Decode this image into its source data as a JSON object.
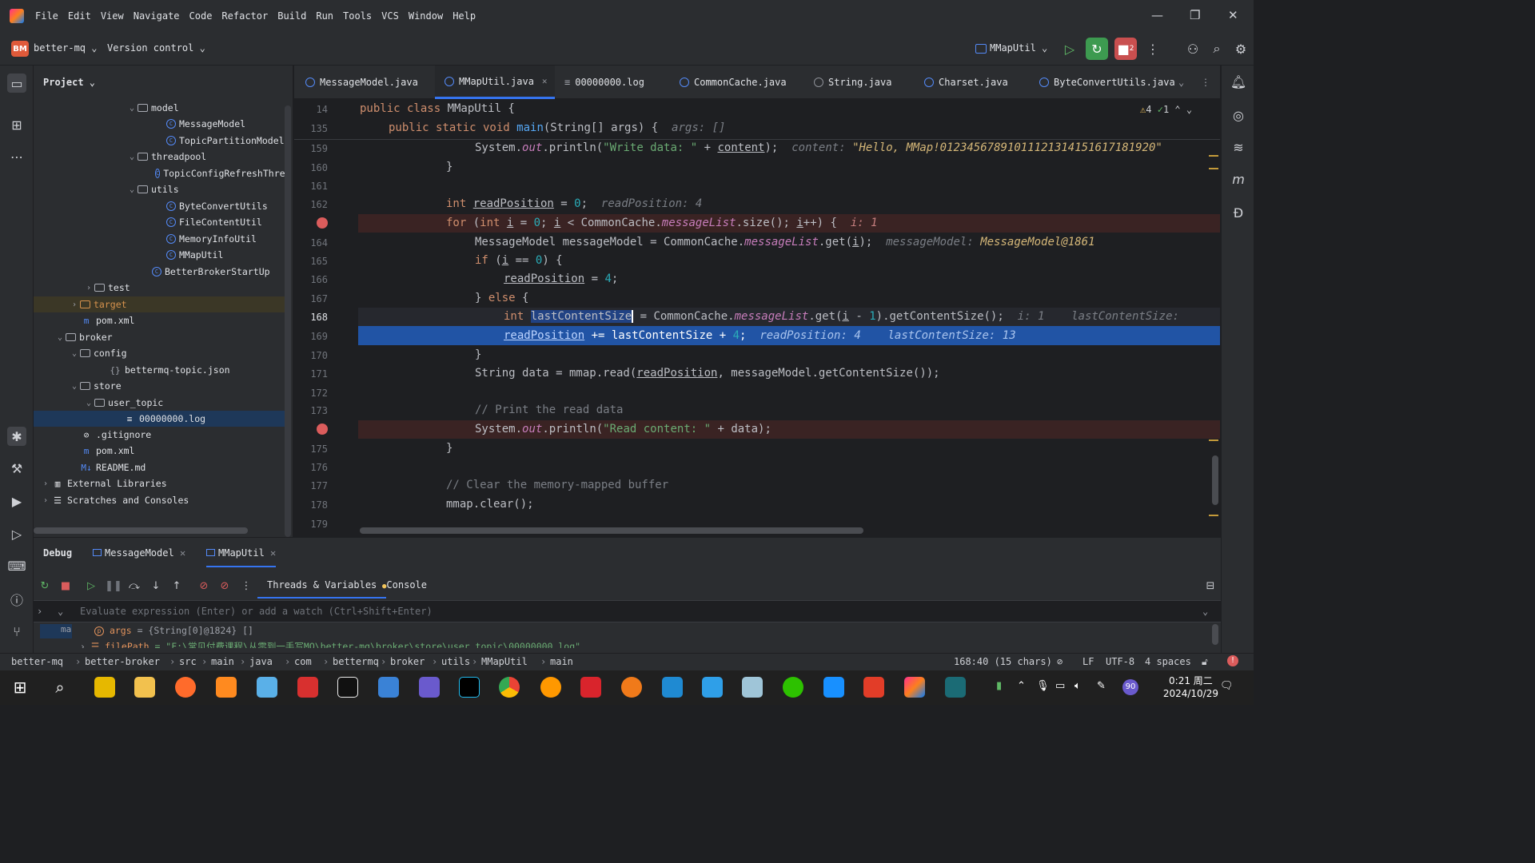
{
  "menu": [
    "File",
    "Edit",
    "View",
    "Navigate",
    "Code",
    "Refactor",
    "Build",
    "Run",
    "Tools",
    "VCS",
    "Window",
    "Help"
  ],
  "toolbar": {
    "project_badge": "BM",
    "project_name": "better-mq",
    "vcs": "Version control",
    "run_config": "MMapUtil",
    "stop_count": "2"
  },
  "project_panel": {
    "title": "Project",
    "rows": [
      {
        "label": "model",
        "depth": 6,
        "type": "folder",
        "arrow": "open"
      },
      {
        "label": "MessageModel",
        "depth": 8,
        "type": "class"
      },
      {
        "label": "TopicPartitionModel",
        "depth": 8,
        "type": "class"
      },
      {
        "label": "threadpool",
        "depth": 6,
        "type": "folder",
        "arrow": "open"
      },
      {
        "label": "TopicConfigRefreshThread",
        "depth": 8,
        "type": "class"
      },
      {
        "label": "utils",
        "depth": 6,
        "type": "folder",
        "arrow": "open"
      },
      {
        "label": "ByteConvertUtils",
        "depth": 8,
        "type": "class"
      },
      {
        "label": "FileContentUtil",
        "depth": 8,
        "type": "class"
      },
      {
        "label": "MemoryInfoUtil",
        "depth": 8,
        "type": "class"
      },
      {
        "label": "MMapUtil",
        "depth": 8,
        "type": "class"
      },
      {
        "label": "BetterBrokerStartUp",
        "depth": 7,
        "type": "class"
      },
      {
        "label": "test",
        "depth": 3,
        "type": "folder",
        "arrow": "closed"
      },
      {
        "label": "target",
        "depth": 2,
        "type": "folder-orange",
        "arrow": "closed"
      },
      {
        "label": "pom.xml",
        "depth": 2,
        "type": "maven"
      },
      {
        "label": "broker",
        "depth": 1,
        "type": "folder",
        "arrow": "open"
      },
      {
        "label": "config",
        "depth": 2,
        "type": "folder",
        "arrow": "open"
      },
      {
        "label": "bettermq-topic.json",
        "depth": 4,
        "type": "json"
      },
      {
        "label": "store",
        "depth": 2,
        "type": "folder",
        "arrow": "open"
      },
      {
        "label": "user_topic",
        "depth": 3,
        "type": "folder",
        "arrow": "open"
      },
      {
        "label": "00000000.log",
        "depth": 5,
        "type": "log"
      },
      {
        "label": ".gitignore",
        "depth": 2,
        "type": "ignore"
      },
      {
        "label": "pom.xml",
        "depth": 2,
        "type": "maven"
      },
      {
        "label": "README.md",
        "depth": 2,
        "type": "md"
      },
      {
        "label": "External Libraries",
        "depth": 0,
        "type": "lib",
        "arrow": "closed"
      },
      {
        "label": "Scratches and Consoles",
        "depth": 0,
        "type": "scratch",
        "arrow": "closed"
      }
    ]
  },
  "tabs": [
    {
      "label": "MessageModel.java",
      "active": false
    },
    {
      "label": "MMapUtil.java",
      "active": true
    },
    {
      "label": "00000000.log",
      "active": false
    },
    {
      "label": "CommonCache.java",
      "active": false
    },
    {
      "label": "String.java",
      "active": false
    },
    {
      "label": "Charset.java",
      "active": false
    },
    {
      "label": "ByteConvertUtils.java",
      "active": false
    }
  ],
  "editor": {
    "warnings": "4",
    "checks": "1",
    "lines": [
      "14",
      "135",
      "159",
      "160",
      "161",
      "162",
      "",
      "164",
      "165",
      "166",
      "167",
      "168",
      "169",
      "170",
      "171",
      "172",
      "173",
      "",
      "175",
      "176",
      "177",
      "178",
      "179"
    ],
    "sticky1": {
      "kw": "public class ",
      "name": "MMapUtil {"
    },
    "sticky2": {
      "kw": "public static void ",
      "fn": "main",
      "rest": "(String[] args) {",
      "hint": "args: []"
    },
    "l159": {
      "a": "System.",
      "b": "out",
      "c": ".println(",
      "s": "\"Write data: \"",
      "d": " + ",
      "e": "content",
      "f": ");",
      "hint": "content: ",
      "hv": "\"Hello, MMap!01234567891011121314151617181920\""
    },
    "l160": "}",
    "l162": {
      "kw": "int ",
      "v": "readPosition",
      "r": " = ",
      "n": "0",
      "e": ";",
      "hint": "readPosition: 4"
    },
    "l163": {
      "kw": "for ",
      "a": "(",
      "kw2": "int ",
      "i": "i",
      "b": " = ",
      "n": "0",
      "c": "; ",
      "i2": "i",
      "d": " < CommonCache.",
      "it": "messageList",
      "e": ".size(); ",
      "i3": "i",
      "f": "++) {",
      "hint": "i: 1"
    },
    "l164": {
      "a": "MessageModel messageModel = CommonCache.",
      "it": "messageList",
      "b": ".get(",
      "i": "i",
      "c": ");",
      "hint": "messageModel: ",
      "hv": "MessageModel@1861"
    },
    "l165": {
      "kw": "if ",
      "a": "(",
      "i": "i",
      "b": " == ",
      "n": "0",
      "c": ") {"
    },
    "l166": {
      "v": "readPosition",
      "a": " = ",
      "n": "4",
      "b": ";"
    },
    "l167": {
      "a": "} ",
      "kw": "else ",
      "b": "{"
    },
    "l168": {
      "kw": "int ",
      "v": "lastContentSize",
      "a": " = CommonCache.",
      "it": "messageList",
      "b": ".get(",
      "i": "i",
      "c": " - ",
      "n": "1",
      "d": ").getContentSize();",
      "hint": "i: 1",
      "hint2": "lastContentSize:"
    },
    "l169": {
      "v": "readPosition",
      "a": " += lastContentSize + ",
      "n": "4",
      "b": ";",
      "hint": "readPosition: 4",
      "hint2": "lastContentSize: 13"
    },
    "l170": "}",
    "l171": {
      "a": "String data = mmap.read(",
      "v": "readPosition",
      "b": ", messageModel.getContentSize());"
    },
    "l173": "// Print the read data",
    "l174": {
      "a": "System.",
      "it": "out",
      "b": ".println(",
      "s": "\"Read content: \"",
      "c": " + data);"
    },
    "l175": "}",
    "l177": "// Clear the memory-mapped buffer",
    "l178": "mmap.clear();"
  },
  "debug": {
    "title": "Debug",
    "tabs": [
      "MessageModel",
      "MMapUtil"
    ],
    "subtabs": [
      "Threads & Variables",
      "Console"
    ],
    "eval_placeholder": "Evaluate expression (Enter) or add a watch (Ctrl+Shift+Enter)",
    "frame": "ma",
    "var1": {
      "name": "args",
      "value": " = {String[0]@1824} []"
    },
    "var2": {
      "name": "filePath",
      "value": " = \"F:\\常见付费课程\\从零到一手写MQ\\better-mq\\broker\\store\\user_topic\\00000000.log\""
    }
  },
  "statusbar": {
    "crumbs": [
      "better-mq",
      "better-broker",
      "src",
      "main",
      "java",
      "com",
      "bettermq",
      "broker",
      "utils",
      "MMapUtil",
      "main"
    ],
    "position": "168:40 (15 chars)",
    "line_sep": "LF",
    "encoding": "UTF-8",
    "indent": "4 spaces"
  },
  "taskbar": {
    "time": "0:21 周二",
    "date": "2024/10/29",
    "badge": "90"
  }
}
